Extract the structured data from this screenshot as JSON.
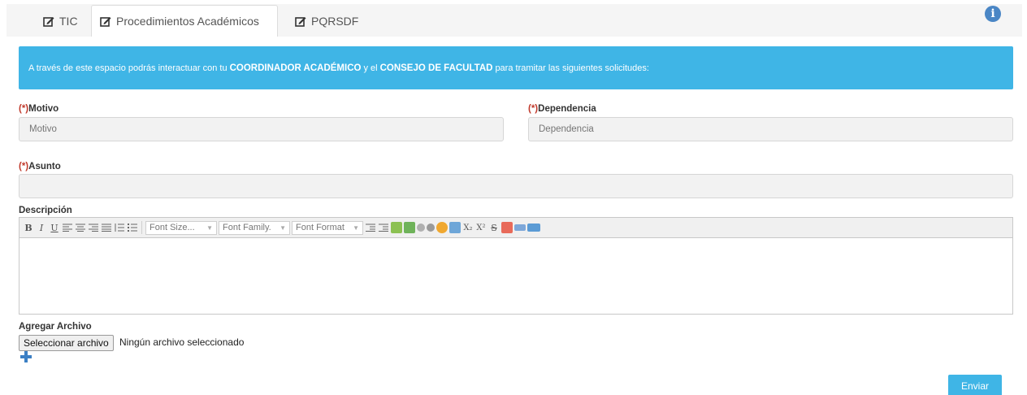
{
  "tabs": [
    {
      "label": "TIC",
      "icon": "edit-icon"
    },
    {
      "label": "Procedimientos Académicos",
      "icon": "edit-icon",
      "active": true
    },
    {
      "label": "PQRSDF",
      "icon": "edit-icon"
    }
  ],
  "alert": {
    "text1": "A través de este espacio podrás interactuar con tu",
    "bold1": "COORDINADOR ACADÉMICO",
    "text2": "y el",
    "bold2": "CONSEJO DE FACULTAD",
    "text3": "para tramitar las siguientes solicitudes:"
  },
  "form": {
    "required_mark": "(*)",
    "motivo_label": "Motivo",
    "motivo_placeholder": "Motivo",
    "dependencia_label": "Dependencia",
    "dependencia_placeholder": "Dependencia",
    "asunto_label": "Asunto",
    "asunto_value": "",
    "descripcion_label": "Descripción",
    "agregar_label": "Agregar Archivo",
    "file_button": "Seleccionar archivo",
    "file_status": "Ningún archivo seleccionado",
    "submit": "Enviar"
  },
  "toolbar": {
    "bold": "B",
    "italic": "I",
    "underline": "U",
    "font_size": "Font Size...",
    "font_family": "Font Family.",
    "font_format": "Font Format",
    "subscript": "X₂",
    "superscript": "X²",
    "strike": "S"
  },
  "colors": {
    "accent": "#3fb5e6",
    "required": "#c0392b",
    "info": "#4a86c5"
  }
}
